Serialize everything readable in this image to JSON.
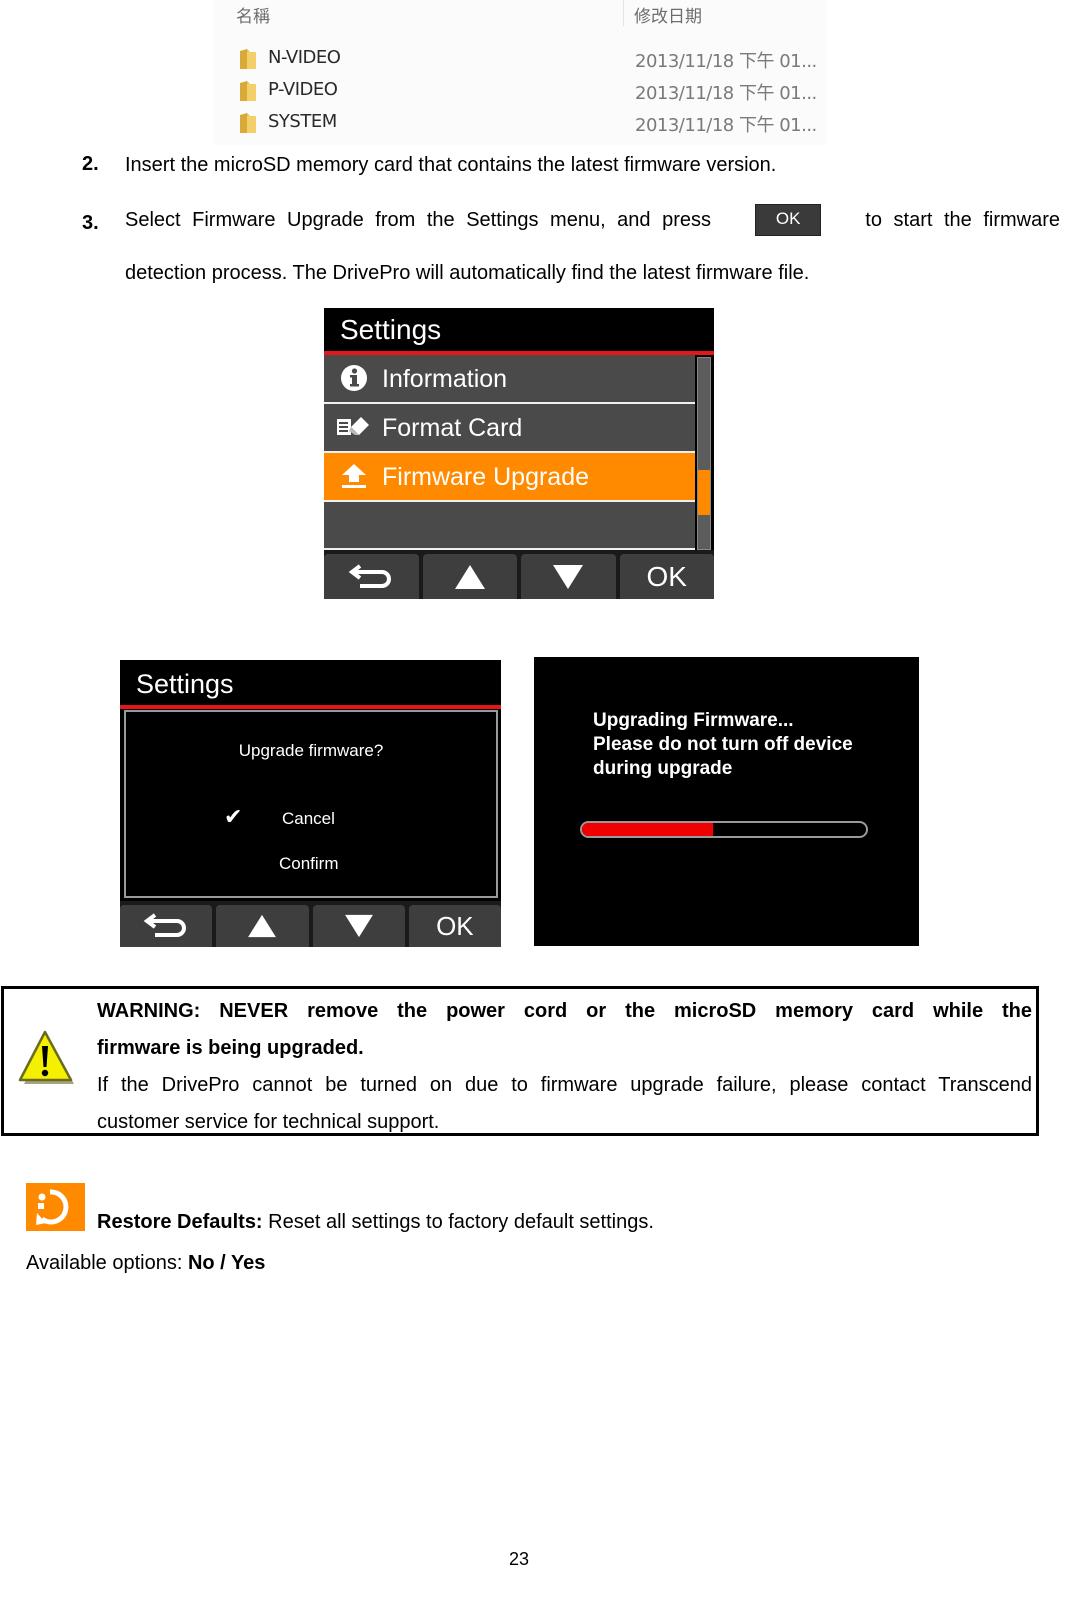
{
  "explorer": {
    "columns": {
      "name": "名稱",
      "modified": "修改日期"
    },
    "folders": [
      {
        "name": "N-VIDEO",
        "modified": "2013/11/18 下午 01..."
      },
      {
        "name": "P-VIDEO",
        "modified": "2013/11/18 下午 01..."
      },
      {
        "name": "SYSTEM",
        "modified": "2013/11/18 下午 01..."
      }
    ]
  },
  "steps": [
    {
      "number": "2.",
      "text": "Insert the microSD memory card that contains the latest firmware version."
    },
    {
      "number": "3.",
      "text_before": "Select Firmware Upgrade from the Settings menu, and press",
      "button_label": "OK",
      "text_after": "to start the firmware",
      "text_line2": "detection process. The DrivePro will automatically find the latest firmware file."
    }
  ],
  "settings_screen": {
    "title": "Settings",
    "items": [
      {
        "label": "Information",
        "icon": "info-icon",
        "active": false
      },
      {
        "label": "Format Card",
        "icon": "format-card-icon",
        "active": false
      },
      {
        "label": "Firmware Upgrade",
        "icon": "upload-icon",
        "active": true
      },
      {
        "label": "",
        "icon": "",
        "active": false
      }
    ],
    "buttons": {
      "back": "back-icon",
      "up": "up-arrow-icon",
      "down": "down-arrow-icon",
      "ok": "OK"
    },
    "colors": {
      "accent": "#ff8a00",
      "title_underline": "#e3161a"
    }
  },
  "confirm_screen": {
    "title": "Settings",
    "question": "Upgrade firmware?",
    "options": [
      {
        "label": "Cancel",
        "selected": true
      },
      {
        "label": "Confirm",
        "selected": false
      }
    ],
    "check_mark": "✔",
    "buttons": {
      "ok": "OK"
    }
  },
  "progress_screen": {
    "lines": [
      "Upgrading Firmware...",
      "Please do not turn off device",
      "during upgrade"
    ],
    "progress_fraction": 0.46,
    "fill_color": "#f00000"
  },
  "warning": {
    "bold_line1": "WARNING: NEVER remove the power cord or the microSD memory card while the",
    "bold_line2": "firmware is being upgraded.",
    "normal_line1": "If the DrivePro cannot be turned on due to firmware upgrade failure, please contact Transcend",
    "normal_line2": "customer service for technical support."
  },
  "restore": {
    "label": "Restore Defaults:",
    "description": " Reset all settings to factory default settings.",
    "options_prefix": "Available options: ",
    "options_value": "No / Yes"
  },
  "page_number": "23"
}
